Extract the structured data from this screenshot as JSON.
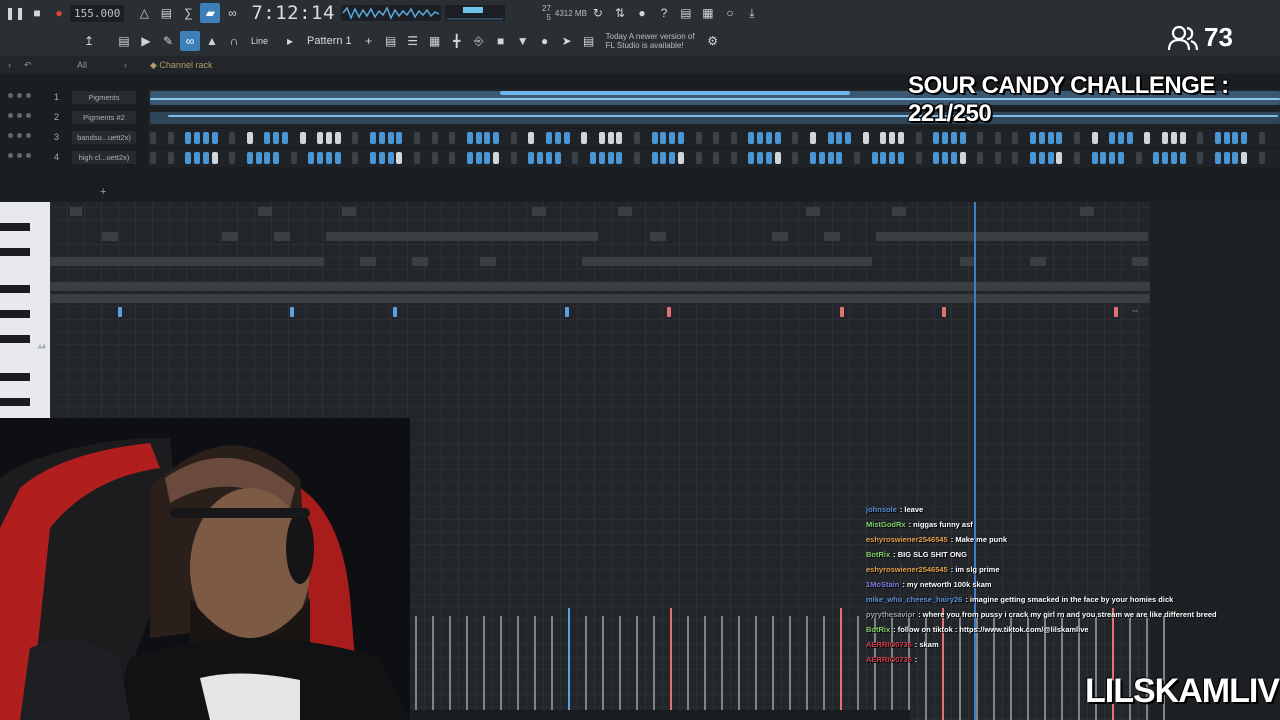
{
  "toolbar": {
    "tempo": "155.000",
    "time": "7:12:14",
    "cpu": "27",
    "mem_mb": "4312 MB",
    "voices": "5",
    "pattern": "Pattern 1",
    "snap": "Line",
    "news_line1": "Today  A newer version of",
    "news_line2": "FL Studio is available!"
  },
  "breadcrumb": {
    "filter": "All",
    "channel_rack": "Channel rack"
  },
  "tracks": [
    {
      "num": "1",
      "name": "Pigments"
    },
    {
      "num": "2",
      "name": "Pigments #2"
    },
    {
      "num": "3",
      "name": "bandsu...uett2x)"
    },
    {
      "num": "4",
      "name": "high cl...uett2x)"
    }
  ],
  "piano_roll": {
    "label_a4": "A4",
    "label_a3": "A3"
  },
  "overlay": {
    "title": "SOUR CANDY CHALLENGE : 221/250",
    "viewers": "73",
    "brand": "LILSKAMLIVE"
  },
  "chat": [
    {
      "user": "johnsole",
      "text": " : leave",
      "color": "#5a8fd6"
    },
    {
      "user": "MistGodRx",
      "text": " : niggas funny asf",
      "color": "#7fd36b"
    },
    {
      "user": "eshyroswiener2546545",
      "text": " : Make me punk",
      "color": "#e2a14a"
    },
    {
      "user": "BotRix",
      "text": " : BIG SLG SHIT ONG",
      "color": "#7fd36b"
    },
    {
      "user": "eshyroswiener2546545",
      "text": " : im slg prime",
      "color": "#e2a14a"
    },
    {
      "user": "1MoStain",
      "text": " : my networth 100k skam",
      "color": "#7b7ee8"
    },
    {
      "user": "mike_who_cheese_hairy26",
      "text": " : imagine getting smacked in the face by your homies dick",
      "color": "#5a8fd6"
    },
    {
      "user": "pyrythesavior",
      "text": " : where you from pussy i crack my girl rn and you stream we are like different breed",
      "color": "#9aa4ad"
    },
    {
      "user": "BotRix",
      "text": " : follow on tiktok : https://www.tiktok.com/@lilskamlive",
      "color": "#7fd36b"
    },
    {
      "user": "AERRIO0736",
      "text": " : skam",
      "color": "#d23b4a"
    },
    {
      "user": "AERRIO0736",
      "text": " : ",
      "color": "#d23b4a"
    }
  ],
  "colors": {
    "accent_blue": "#3d7fb8",
    "note_blue": "#56a3e0",
    "marker_red": "#e0736f",
    "record_red": "#e0453b"
  }
}
